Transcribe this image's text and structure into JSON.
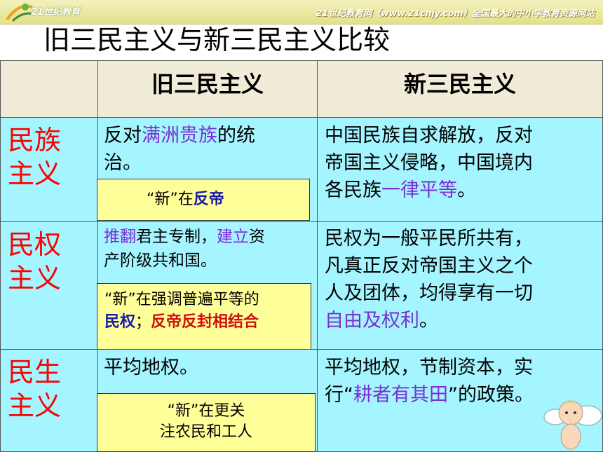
{
  "banner": {
    "logo_text": "21世纪教育",
    "tagline": "21世纪教育网（www.21cnjy.com）全国最大的中小学教育资源网站"
  },
  "title": "旧三民主义与新三民主义比较",
  "table": {
    "col_old": "旧三民主义",
    "col_new": "新三民主义",
    "rows": [
      {
        "head_line1": "民族",
        "head_line2": "主义",
        "old_pre": "反对",
        "old_hl": "满洲贵族",
        "old_post1": "的统",
        "old_post2": "治。",
        "note_pre": "“新”在",
        "note_hl": "反帝",
        "new_line1": "中国民族自求解放，反对",
        "new_line2": "帝国主义侵略，中国境内",
        "new_line3_pre": "各民族",
        "new_line3_hl": "一律平等",
        "new_line3_post": "。"
      },
      {
        "head_line1": "民权",
        "head_line2": "主义",
        "old_hl1": "推翻",
        "old_mid": "君主专制，",
        "old_hl2": "建立",
        "old_post1": "资",
        "old_line2": "产阶级共和国。",
        "note_line1": "“新”在强调普遍平等的",
        "note_hl1": "民权",
        "note_sep": "；",
        "note_hl2": "反帝反封相结合",
        "new_line1": "民权为一般平民所共有，",
        "new_line2": "凡真正反对帝国主义之个",
        "new_line3": "人及团体，均得享有一切",
        "new_line4_hl": "自由及权利",
        "new_line4_post": "。"
      },
      {
        "head_line1": "民生",
        "head_line2": "主义",
        "old_line1": "平均地权。",
        "note_line1": "“新”在更关",
        "note_line2": "注农民和工人",
        "new_line1": "平均地权，节制资本，实",
        "new_line2_pre": "行“",
        "new_line2_hl": "耕者有其田",
        "new_line2_post": "”的政策。"
      }
    ]
  },
  "colors": {
    "header_bg": "#f0ecd8",
    "cell_bg": "#a4f5ff",
    "note_bg": "#ffff99",
    "row_head": "#ff0000",
    "highlight": "#7b2fd6"
  }
}
